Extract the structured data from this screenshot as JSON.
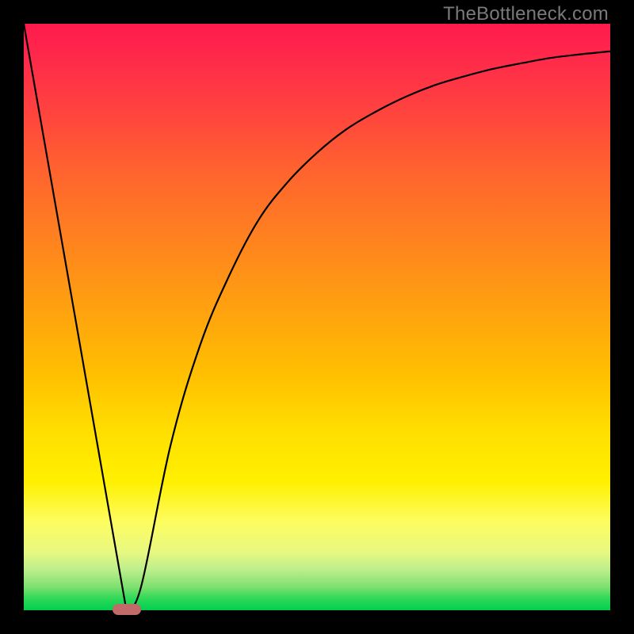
{
  "attribution": "TheBottleneck.com",
  "chart_data": {
    "type": "line",
    "title": "",
    "xlabel": "",
    "ylabel": "",
    "xlim": [
      0,
      100
    ],
    "ylim": [
      0,
      100
    ],
    "series": [
      {
        "name": "bottleneck-curve",
        "x": [
          0,
          17.5,
          20,
          25,
          30,
          35,
          40,
          45,
          50,
          55,
          60,
          65,
          70,
          75,
          80,
          85,
          90,
          95,
          100
        ],
        "y": [
          100,
          0,
          4,
          28,
          45,
          57,
          66.5,
          73,
          78,
          82,
          85,
          87.5,
          89.5,
          91,
          92.3,
          93.3,
          94.2,
          94.8,
          95.3
        ]
      }
    ],
    "annotations": [
      {
        "name": "minimum-marker",
        "x": 17.5,
        "y": 0
      }
    ],
    "gradient": {
      "top": "#ff1a4d",
      "bottom": "#00d050"
    }
  }
}
